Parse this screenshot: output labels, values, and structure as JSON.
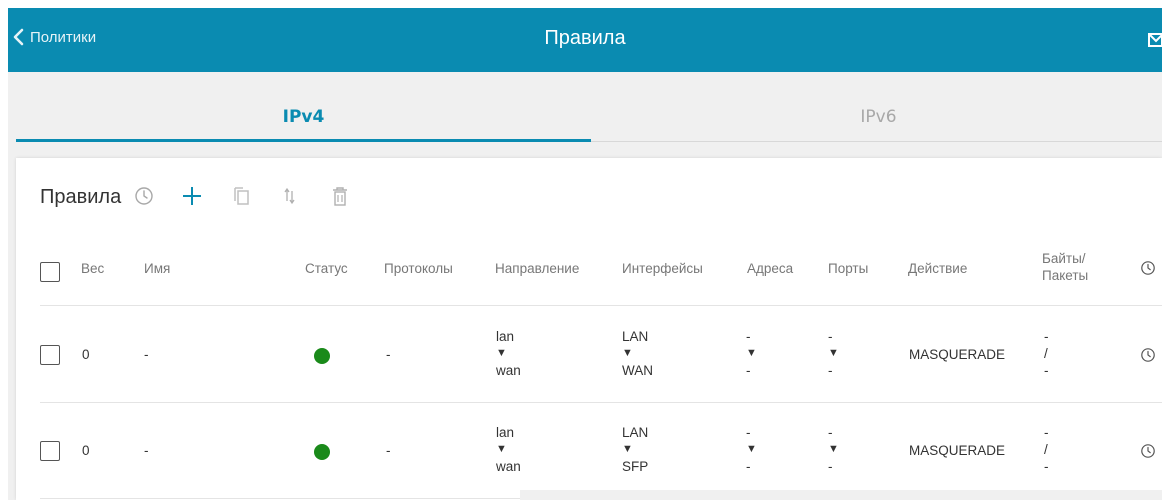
{
  "header": {
    "back_label": "Политики",
    "title": "Правила"
  },
  "tabs": [
    {
      "label": "IPv4",
      "active": true
    },
    {
      "label": "IPv6",
      "active": false
    }
  ],
  "section": {
    "title": "Правила"
  },
  "table": {
    "columns": [
      "Вес",
      "Имя",
      "Статус",
      "Протоколы",
      "Направление",
      "Интерфейсы",
      "Адреса",
      "Порты",
      "Действие",
      "Байты/\nПакеты"
    ],
    "rows": [
      {
        "weight": "0",
        "name": "-",
        "status": "active",
        "protocols": "-",
        "direction": {
          "from": "lan",
          "arrow": "▼",
          "to": "wan"
        },
        "interfaces": {
          "from": "LAN",
          "arrow": "▼",
          "to": "WAN"
        },
        "addresses": {
          "from": "-",
          "arrow": "▼",
          "to": "-"
        },
        "ports": {
          "from": "-",
          "arrow": "▼",
          "to": "-"
        },
        "action": "MASQUERADE",
        "bytes_packets": {
          "bytes": "-",
          "sep": "/",
          "packets": "-"
        }
      },
      {
        "weight": "0",
        "name": "-",
        "status": "active",
        "protocols": "-",
        "direction": {
          "from": "lan",
          "arrow": "▼",
          "to": "wan"
        },
        "interfaces": {
          "from": "LAN",
          "arrow": "▼",
          "to": "SFP"
        },
        "addresses": {
          "from": "-",
          "arrow": "▼",
          "to": "-"
        },
        "ports": {
          "from": "-",
          "arrow": "▼",
          "to": "-"
        },
        "action": "MASQUERADE",
        "bytes_packets": {
          "bytes": "-",
          "sep": "/",
          "packets": "-"
        }
      }
    ]
  },
  "colors": {
    "accent": "#0a8bb1",
    "status_active": "#1a8a1a"
  },
  "icons": {
    "back": "chevron-left-icon",
    "mail": "mail-icon",
    "schedule": "clock-icon",
    "add": "plus-icon",
    "copy": "copy-icon",
    "sort": "sort-arrows-icon",
    "delete": "trash-icon"
  }
}
